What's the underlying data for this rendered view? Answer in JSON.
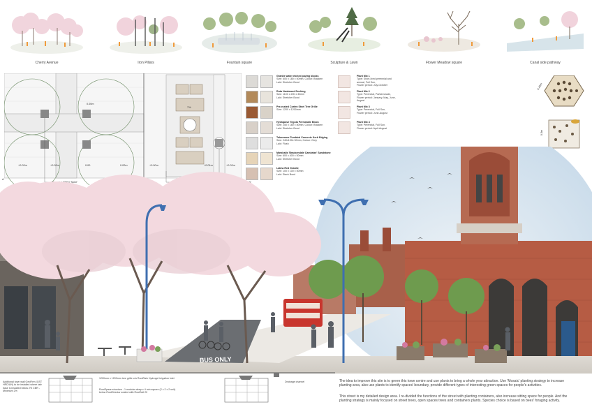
{
  "vignettes": [
    {
      "caption": "Cherry Avenue"
    },
    {
      "caption": "Iron Pillars"
    },
    {
      "caption": "Fountain square"
    },
    {
      "caption": "Sculpture & Lawn"
    },
    {
      "caption": "Flower Meadow square"
    },
    {
      "caption": "Canal side pathway"
    }
  ],
  "plan": {
    "labels": {
      "tree": "Prunus x hillieri 'Spire'",
      "drainage": "Drainage channel",
      "salix": "Salix caprea 'Kilmarnock'",
      "dim1": "0.00m",
      "dim2": "+0.02m",
      "dim3": "+0.02m",
      "dim4": "0.00",
      "dim5": "0.02m",
      "dim6": "+0.00m",
      "dim7": "+0.01m",
      "dim8": "+0.02m",
      "plaza": "7%",
      "sec_a_left": "A",
      "sec_a_right": "A'"
    }
  },
  "materials": [
    {
      "name": "Granite water etched paving blocks",
      "spec": "Size: 600 x 180 x 50mm, Colour: Bracken",
      "lay": "Laid: Stretcher Bond",
      "sw1": "#dcdad6",
      "sw2": "#e6e4e0"
    },
    {
      "name": "Ruta Hardwood Decking",
      "spec": "Size: 1100 x 200 x 30mm",
      "lay": "Laid: Stretcher Bond",
      "sw1": "#b38a5a",
      "sw2": "#e8e4dc"
    },
    {
      "name": "Pre-rusted Corten Steel Tree Grille",
      "spec": "Size: 1200 x 1200mm",
      "lay": "",
      "sw1": "#9a5a34",
      "sw2": "#d9d2c8"
    },
    {
      "name": "Hydrapave Tegula Permeable Block",
      "spec": "Size: 250 x 180 x 80mm, Colour: Bracken",
      "lay": "Laid: Stretcher Bond",
      "sw1": "#d8d0c8",
      "sw2": "#e4ddd6"
    },
    {
      "name": "Tobermore Tumbled Concrete Kerb Edging",
      "spec": "Size: 240x190x 50mm, Colour: Grey",
      "lay": "Laid: Flush",
      "sw1": "#dedede",
      "sw2": "#ebebeb"
    },
    {
      "name": "Marshalls 'Brackendale Cambrian' Sandstone",
      "spec": "Size: 600 x 400 x 50mm",
      "lay": "Laid: Stretcher Bond",
      "sw1": "#e6d4b8",
      "sw2": "#efe4d2"
    },
    {
      "name": "Lakha Red Granite",
      "spec": "Size: 100 x 100 x 50mm",
      "lay": "Laid: Stack Bond",
      "sw1": "#d6c0b2",
      "sw2": "#e6d8cc"
    }
  ],
  "plants": [
    {
      "name": "Plant Mix 1",
      "l1": "Type: Short-lived perennial and annual, Full Sun,",
      "l2": "Flower period: July-October"
    },
    {
      "name": "Plant Mix 2",
      "l1": "Type: Perennial, Partial shade,",
      "l2": "Flower period: January, May, June, August"
    },
    {
      "name": "Plant Mix 3",
      "l1": "Type: Perennial, Full Sun,",
      "l2": "Flower period: June-August"
    },
    {
      "name": "Plant Mix 4",
      "l1": "Type: Perennial, Full Sun,",
      "l2": "Flower period: April-August"
    }
  ],
  "bughotel": {
    "dim1": "0.45m",
    "dim2": "0.5m"
  },
  "scene": {
    "bus_lane": "BUS ONLY"
  },
  "section_notes": {
    "left": "Additional town wall GeoFirm (GST HRD/UN) to be installed where tale base is installed below 2% CBR - Minimum 2%",
    "treepit1": "1200mm x 1200mm tree grille c/w RootRain Hydrogel irrigation inlet",
    "treepit2": "RootSpace structure - 1 modular deep x 4 min square (2 x 2 x 2 unit) below RootDirector sealed with RootSoil 20",
    "drainage": "Drainage channel"
  },
  "paragraphs": {
    "p1": "The idea to improve this site is to green this town centre and use plants to bring a whole year attraction. Use 'Mosaic' planting strategy to increase planting area, also use plants to identify spaces' boundary, provide different types of interesting green spaces for people's activities.",
    "p2": "This street is my detailed design area. I re-divided the functions of the street with planting containers, also increase sitting space for people. And the planting strategy is mainly focused on street trees, open spaces trees and containers plants. Species choice is based on bees' foraging activity."
  },
  "colors": {
    "blossom": "#f3d9df",
    "brick": "#b65c44",
    "sky": "#dbe7f2",
    "lamp": "#3f6fb0",
    "bus": "#c8362e"
  }
}
